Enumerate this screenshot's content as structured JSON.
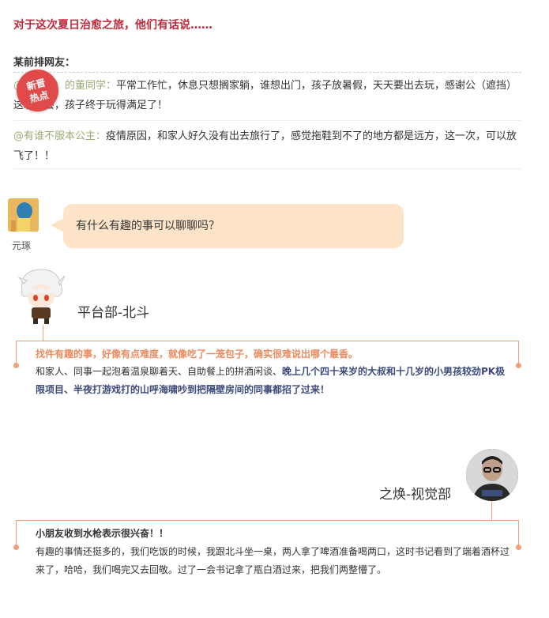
{
  "headline": "对于这次夏日治愈之旅，他们有话说……",
  "section_label": "某前排网友：",
  "badge": {
    "line1": "新晋",
    "line2": "热点"
  },
  "comments": [
    {
      "user": "@（遮挡）的董同学：",
      "text": "平常工作忙，休息只想搁家躺，谁想出门，孩子放暑假，天天要出去玩，感谢公（遮挡）这次机会，孩子终于玩得满足了！"
    },
    {
      "user": "@有谁不服本公主：",
      "text": "疫情原因，和家人好久没有出去旅行了，感觉拖鞋到不了的地方都是远方，这一次，可以放飞了！！"
    }
  ],
  "question": {
    "avatar_name": "元琢",
    "text": "有什么有趣的事可以聊聊吗？"
  },
  "speaker1": {
    "name": "平台部-北斗",
    "highlight": "找件有趣的事，好像有点难度，就像吃了一笼包子，确实很难说出哪个最香。",
    "body_plain": "和家人、同事一起泡着温泉聊着天、自助餐上的拼酒闲谈、",
    "body_strong": "晚上几个四十来岁的大叔和十几岁的小男孩较劲PK极限项目、半夜打游戏打的山呼海啸吵到把隔壁房间的同事都招了过来！"
  },
  "speaker2": {
    "name": "之焕-视觉部",
    "title": "小朋友收到水枪表示很兴奋！！",
    "body": "有趣的事情还挺多的，我们吃饭的时候，我跟北斗坐一桌，两人拿了啤酒准备喝两口，这时书记看到了端着酒杯过来了，哈哈，我们喝完又去回敬。过了一会书记拿了瓶白酒过来，把我们两整懵了。"
  },
  "colors": {
    "headline": "#c0293b",
    "accent": "#f0a07a",
    "user": "#9bab72",
    "bubble": "#fde4c9",
    "badge": "#e04a4a"
  }
}
